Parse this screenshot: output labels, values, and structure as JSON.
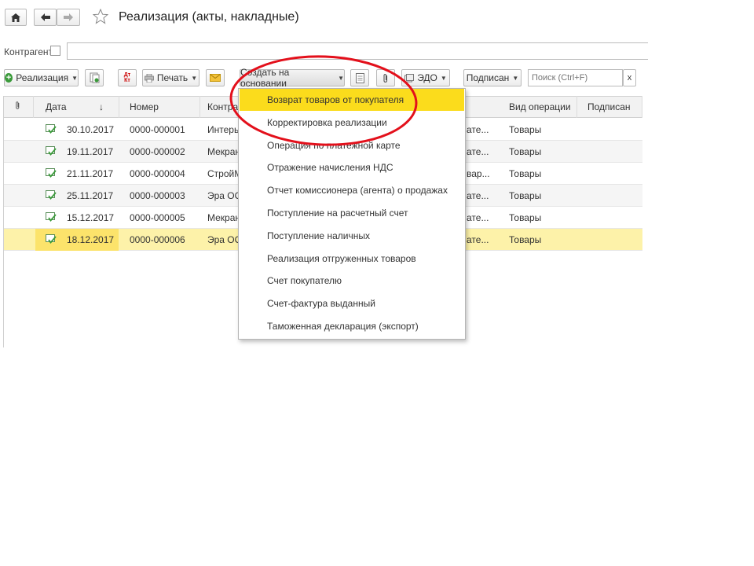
{
  "window": {
    "title": "Реализация (акты, накладные)"
  },
  "nav": {
    "home_icon": "home-icon",
    "back_icon": "arrow-left-icon",
    "forward_icon": "arrow-right-icon",
    "favorite_icon": "star-icon"
  },
  "filter": {
    "counterparty_label": "Контрагент:",
    "counterparty_value": ""
  },
  "toolbar": {
    "realization_label": "Реализация",
    "print_label": "Печать",
    "create_based_label": "Создать на основании",
    "edo_label": "ЭДО",
    "signed_label": "Подписан",
    "search_placeholder": "Поиск (Ctrl+F)",
    "search_clear": "x"
  },
  "table": {
    "headers": {
      "attach": "",
      "date": "Дата",
      "sort_arrow": "↓",
      "number": "Номер",
      "counterparty": "Контрагент",
      "operation": "Вид операции",
      "signed": "Подписан"
    },
    "rows": [
      {
        "date": "30.10.2017",
        "number": "0000-000001",
        "counterparty": "Интерье",
        "trunc": "ате...",
        "operation": "Товары"
      },
      {
        "date": "19.11.2017",
        "number": "0000-000002",
        "counterparty": "Мекран",
        "trunc": "ате...",
        "operation": "Товары"
      },
      {
        "date": "21.11.2017",
        "number": "0000-000004",
        "counterparty": "СтройМ",
        "trunc": "вар...",
        "operation": "Товары"
      },
      {
        "date": "25.11.2017",
        "number": "0000-000003",
        "counterparty": "Эра ОО",
        "trunc": "ате...",
        "operation": "Товары"
      },
      {
        "date": "15.12.2017",
        "number": "0000-000005",
        "counterparty": "Мекран",
        "trunc": "ате...",
        "operation": "Товары"
      },
      {
        "date": "18.12.2017",
        "number": "0000-000006",
        "counterparty": "Эра ОО",
        "trunc": "ате...",
        "operation": "Товары"
      }
    ]
  },
  "menu": {
    "items": [
      "Возврат товаров от покупателя",
      "Корректировка реализации",
      "Операция по платежной карте",
      "Отражение начисления НДС",
      "Отчет комиссионера (агента) о продажах",
      "Поступление на расчетный счет",
      "Поступление наличных",
      "Реализация отгруженных товаров",
      "Счет покупателю",
      "Счет-фактура выданный",
      "Таможенная декларация (экспорт)"
    ]
  },
  "colors": {
    "highlight": "#fce36b",
    "menu_highlight": "#fbdc1c",
    "annotation": "#e3101b",
    "doc_icon": "#3a9a3a"
  }
}
